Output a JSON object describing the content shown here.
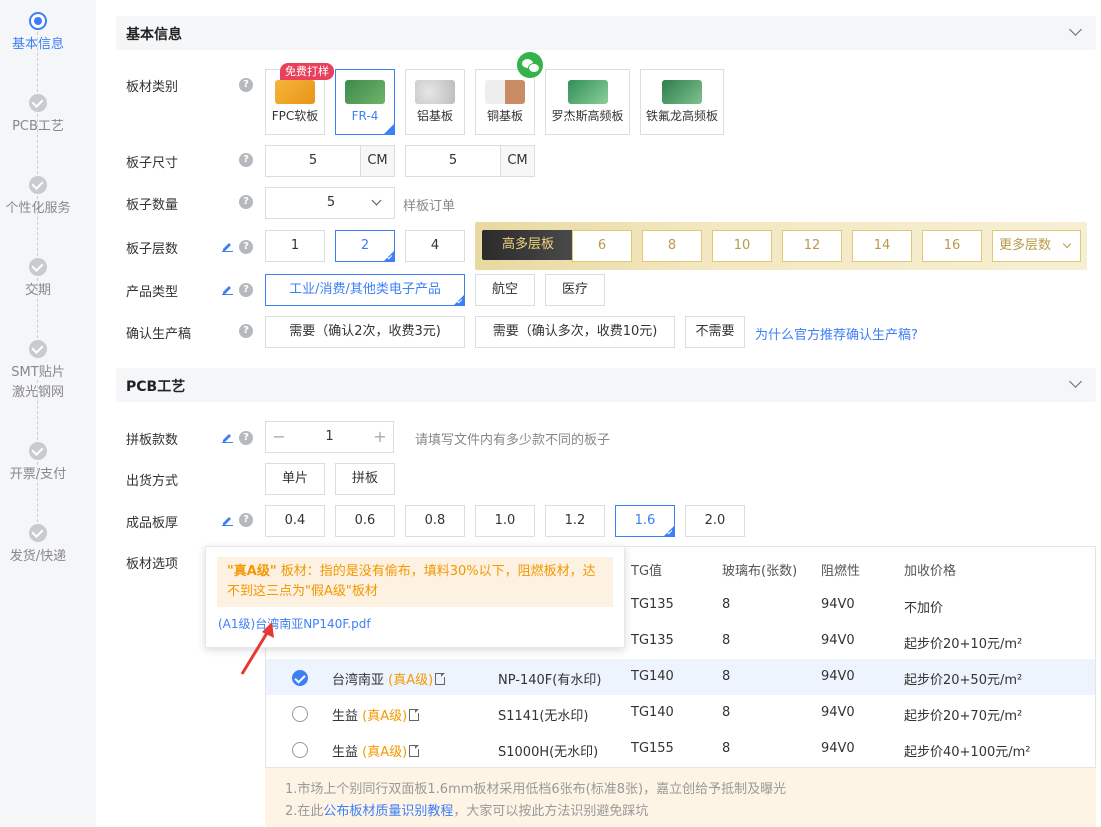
{
  "steps": [
    {
      "label": "基本信息"
    },
    {
      "label": "PCB工艺"
    },
    {
      "label": "个性化服务"
    },
    {
      "label": "交期"
    },
    {
      "label_l1": "SMT贴片",
      "label_l2": "激光钢网"
    },
    {
      "label": "开票/支付"
    },
    {
      "label": "发货/快递"
    }
  ],
  "basic": {
    "title": "基本信息",
    "material": {
      "label": "板材类别",
      "free_tag": "免费打样",
      "options": [
        "FPC软板",
        "FR-4",
        "铝基板",
        "铜基板",
        "罗杰斯高频板",
        "铁氟龙高频板"
      ],
      "selected": "FR-4"
    },
    "size": {
      "label": "板子尺寸",
      "width": "5",
      "height": "5",
      "unit": "CM"
    },
    "qty": {
      "label": "板子数量",
      "value": "5",
      "hint": "样板订单"
    },
    "layers": {
      "label": "板子层数",
      "options": [
        "1",
        "2",
        "4"
      ],
      "selected": "2",
      "high_tag": "高多层板",
      "high_options": [
        "6",
        "8",
        "10",
        "12",
        "14",
        "16"
      ],
      "more": "更多层数"
    },
    "product": {
      "label": "产品类型",
      "options": [
        "工业/消费/其他类电子产品",
        "航空",
        "医疗"
      ],
      "selected": "工业/消费/其他类电子产品"
    },
    "confirm": {
      "label": "确认生产稿",
      "options": [
        "需要（确认2次，收费3元)",
        "需要（确认多次，收费10元)",
        "不需要"
      ],
      "link": "为什么官方推荐确认生产稿?"
    }
  },
  "pcb": {
    "title": "PCB工艺",
    "panel_count": {
      "label": "拼板款数",
      "value": "1",
      "minus": "−",
      "plus": "+",
      "hint": "请填写文件内有多少款不同的板子"
    },
    "shipping": {
      "label": "出货方式",
      "options": [
        "单片",
        "拼板"
      ]
    },
    "thickness": {
      "label": "成品板厚",
      "options": [
        "0.4",
        "0.6",
        "0.8",
        "1.0",
        "1.2",
        "1.6",
        "2.0"
      ],
      "selected": "1.6"
    },
    "board_options": {
      "label": "板材选项",
      "headers": [
        "TG值",
        "玻璃布(张数)",
        "阻燃性",
        "加收价格"
      ],
      "rows": [
        {
          "brand": "",
          "grade": "",
          "model": "",
          "tg": "TG135",
          "glass": "8",
          "flame": "94V0",
          "price": "不加价",
          "checked": false
        },
        {
          "brand": "",
          "grade": "",
          "model": "",
          "tg": "TG135",
          "glass": "8",
          "flame": "94V0",
          "price": "起步价20+10元/m²",
          "checked": false
        },
        {
          "brand": "台湾南亚",
          "grade": "(真A级)",
          "model": "NP-140F(有水印)",
          "tg": "TG140",
          "glass": "8",
          "flame": "94V0",
          "price": "起步价20+50元/m²",
          "checked": true
        },
        {
          "brand": "生益",
          "grade": "(真A级)",
          "model": "S1141(无水印)",
          "tg": "TG140",
          "glass": "8",
          "flame": "94V0",
          "price": "起步价20+70元/m²",
          "checked": false
        },
        {
          "brand": "生益",
          "grade": "(真A级)",
          "model": "S1000H(无水印)",
          "tg": "TG155",
          "glass": "8",
          "flame": "94V0",
          "price": "起步价40+100元/m²",
          "checked": false
        }
      ]
    },
    "popup": {
      "warn_bold": "\"真A级\"",
      "warn_text": " 板材：指的是没有偷布，填料30%以下，阻燃板材，达不到这三点为\"假A级\"板材",
      "link": "(A1级)台湾南亚NP140F.pdf"
    },
    "notice": {
      "line1": "1.市场上个别同行双面板1.6mm板材采用低档6张布(标准8张)，嘉立创给予抵制及曝光",
      "line2_pre": "2.在此",
      "line2_link": "公布板材质量识别教程",
      "line2_post": "，大家可以按此方法识别避免踩坑"
    }
  },
  "colors": {
    "accent": "#3d7ff6",
    "orange": "#f39800",
    "gold": "#b99a45"
  }
}
